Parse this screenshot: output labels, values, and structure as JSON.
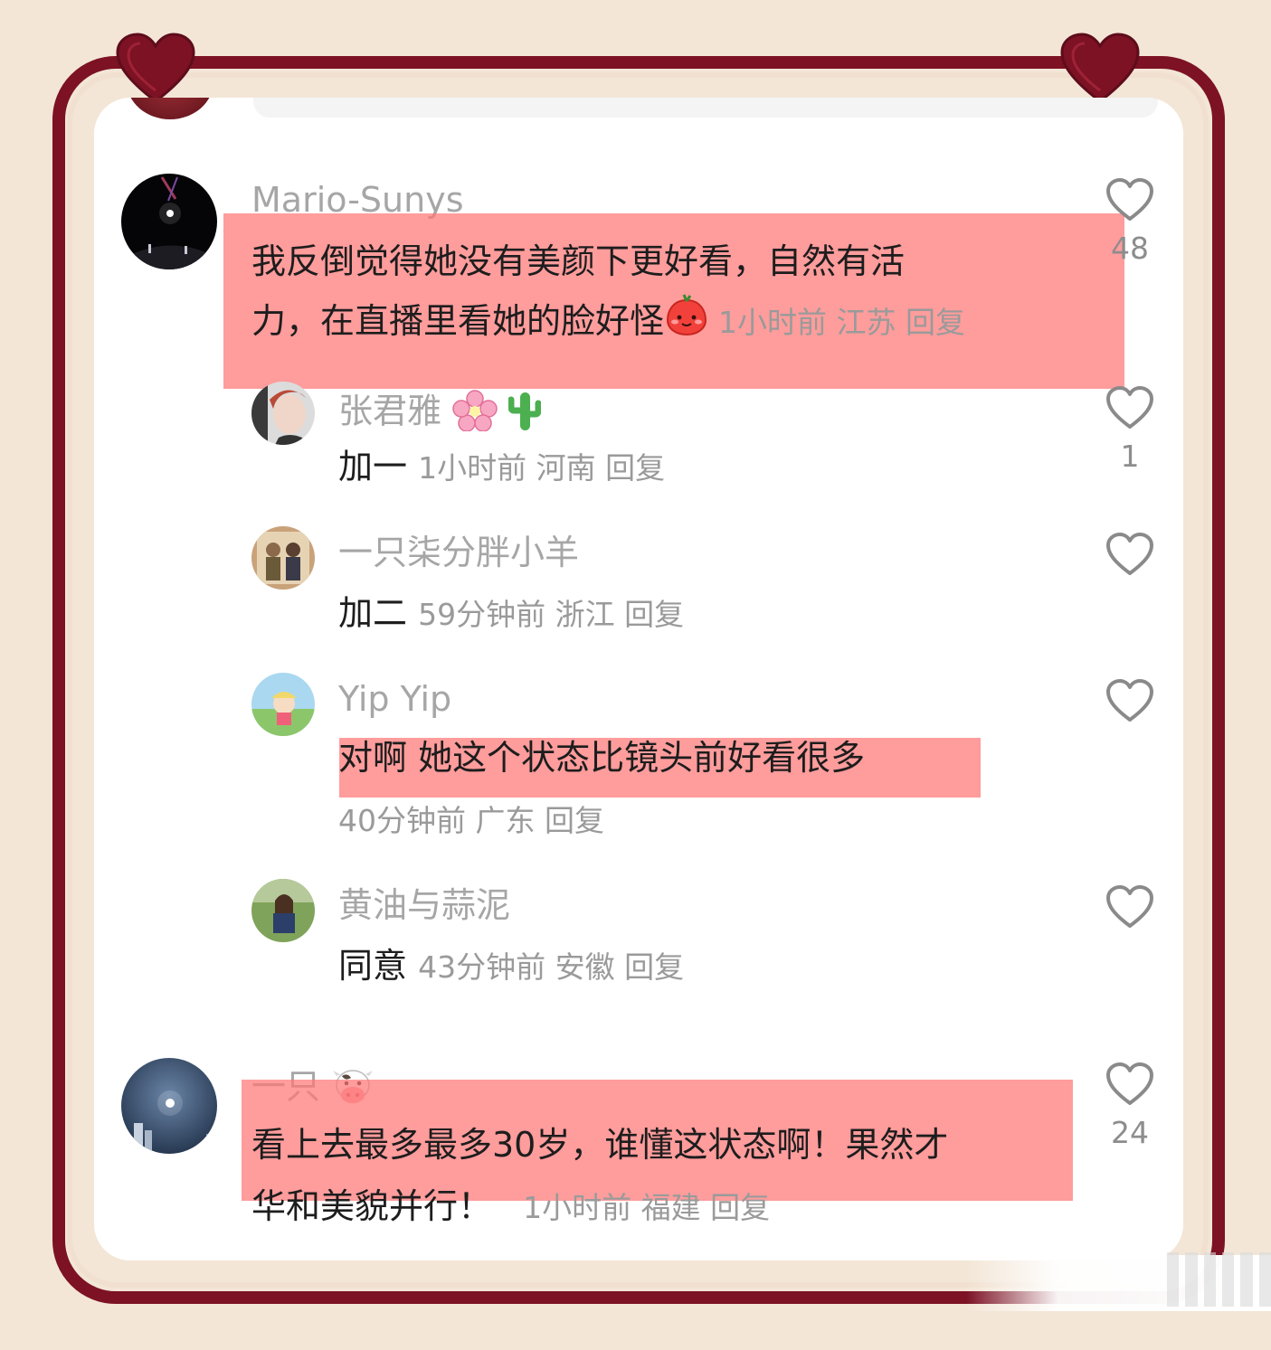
{
  "colors": {
    "frame": "#7c1224",
    "highlight": "#ff7676",
    "background": "#f3e6d7",
    "username": "#a6a6a6",
    "meta": "#9a9a9a"
  },
  "comments": [
    {
      "username": "Mario-Sunys",
      "text_line1": "我反倒觉得她没有美颜下更好看，自然有活",
      "text_line2": "力，在直播里看她的脸好怪",
      "time": "1小时前",
      "location": "江苏",
      "reply": "回复",
      "likes": "48",
      "avatar_icon": "night-stage-avatar",
      "emoji": "apple-face-emoji"
    },
    {
      "username": "张君雅",
      "username_emojis": [
        "cherry-blossom-emoji",
        "cactus-emoji"
      ],
      "text": "加一",
      "time": "1小时前",
      "location": "河南",
      "reply": "回复",
      "likes": "1",
      "avatar_icon": "portrait-avatar"
    },
    {
      "username": "一只柒分胖小羊",
      "text": "加二",
      "time": "59分钟前",
      "location": "浙江",
      "reply": "回复",
      "avatar_icon": "couple-photo-avatar"
    },
    {
      "username": "Yip Yip",
      "text": "对啊 她这个状态比镜头前好看很多",
      "time": "40分钟前",
      "location": "广东",
      "reply": "回复",
      "avatar_icon": "cartoon-boy-avatar"
    },
    {
      "username": "黄油与蒜泥",
      "text": "同意",
      "time": "43分钟前",
      "location": "安徽",
      "reply": "回复",
      "avatar_icon": "outdoor-girl-avatar"
    },
    {
      "username": "一只",
      "username_emojis": [
        "cow-face-emoji"
      ],
      "text_line1": "看上去最多最多30岁，谁懂这状态啊！果然才",
      "text_line2": "华和美貌并行！",
      "time": "1小时前",
      "location": "福建",
      "reply": "回复",
      "likes": "24",
      "avatar_icon": "moon-sky-avatar"
    }
  ]
}
